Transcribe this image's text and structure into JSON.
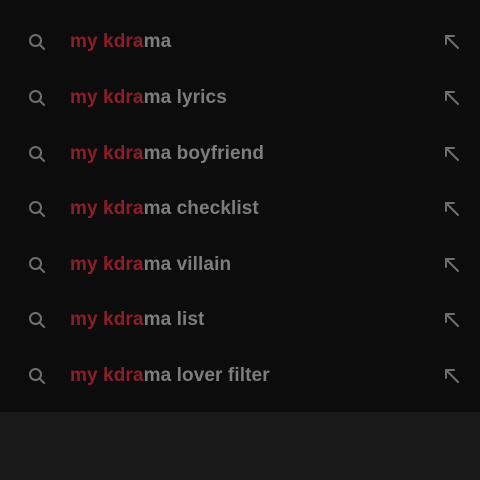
{
  "suggestions": [
    {
      "match": "my kdra",
      "rest": "ma"
    },
    {
      "match": "my kdra",
      "rest": "ma lyrics"
    },
    {
      "match": "my kdra",
      "rest": "ma boyfriend"
    },
    {
      "match": "my kdra",
      "rest": "ma checklist"
    },
    {
      "match": "my kdra",
      "rest": "ma villain"
    },
    {
      "match": "my kdra",
      "rest": "ma list"
    },
    {
      "match": "my kdra",
      "rest": "ma lover filter"
    }
  ],
  "colors": {
    "match": "#8e1d2b",
    "text": "#7d7d7d",
    "icon": "#6f6f6f",
    "background": "#0c0c0c",
    "bottom_bar": "#1a1a1a"
  },
  "icons": {
    "leading": "search-icon",
    "trailing": "arrow-up-left-icon"
  }
}
